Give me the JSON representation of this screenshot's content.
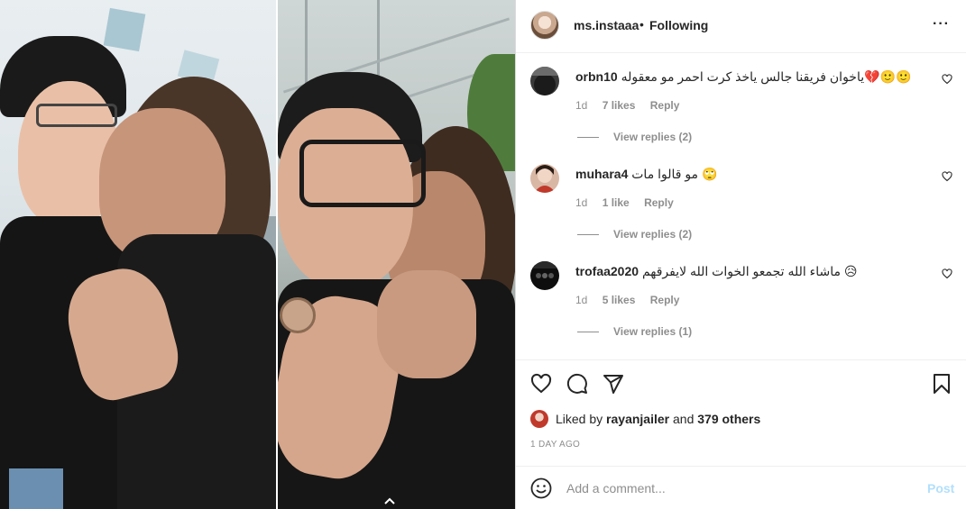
{
  "header": {
    "username": "ms.instaaa",
    "separator": "•",
    "follow_status": "Following",
    "more_glyph": "···"
  },
  "comments": [
    {
      "username": "orbn10",
      "text": "ياخوان فريقنا جالس ياخذ كرت احمر مو معقوله💔🙂🙂",
      "time": "1d",
      "likes": "7 likes",
      "reply": "Reply",
      "view_replies": "View replies (2)"
    },
    {
      "username": "muhara4",
      "text": "مو قالوا مات 🙄",
      "time": "1d",
      "likes": "1 like",
      "reply": "Reply",
      "view_replies": "View replies (2)"
    },
    {
      "username": "trofaa2020",
      "text": "ماشاء الله تجمعو الخوات الله لايفرقهم 😥",
      "time": "1d",
      "likes": "5 likes",
      "reply": "Reply",
      "view_replies": "View replies (1)"
    }
  ],
  "likes": {
    "prefix": "Liked by",
    "user": "rayanjailer",
    "middle": "and",
    "others": "379 others"
  },
  "timestamp": "1 DAY AGO",
  "add_comment": {
    "placeholder": "Add a comment...",
    "post_label": "Post"
  },
  "icons": {
    "like": "heart-icon",
    "comment": "comment-icon",
    "share": "share-icon",
    "save": "bookmark-icon",
    "emoji": "emoji-icon",
    "more": "more-icon",
    "carousel": "chevron-up-icon"
  },
  "colors": {
    "text": "#262626",
    "muted": "#8e8e8e",
    "border": "#efefef",
    "post_disabled": "#b2dffc"
  }
}
